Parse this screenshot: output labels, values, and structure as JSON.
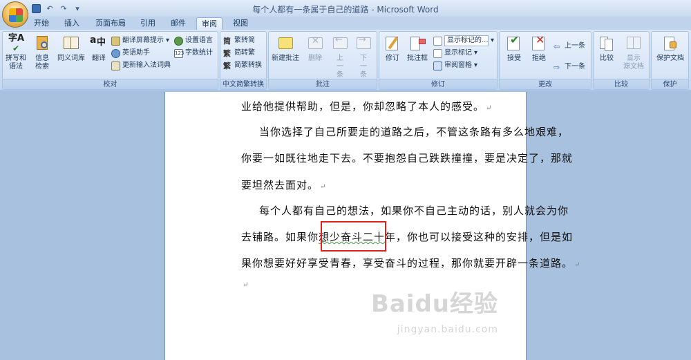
{
  "window": {
    "title": "每个人都有一条属于自己的道路 - Microsoft Word"
  },
  "tabs": [
    "开始",
    "插入",
    "页面布局",
    "引用",
    "邮件",
    "审阅",
    "视图"
  ],
  "active_tab": "审阅",
  "groups": {
    "proofing": {
      "label": "校对",
      "spell": "拼写和\n语法",
      "research": "信息\n检索",
      "thesaurus": "同义词库",
      "translate": "翻译",
      "translate_tip": "翻译屏幕提示",
      "english_assistant": "英语助手",
      "update_ime": "更新输入法词典",
      "set_language": "设置语言",
      "word_count": "字数统计"
    },
    "chinese": {
      "label": "中文简繁转换",
      "to_simplified": "繁转简",
      "to_traditional": "简转繁",
      "convert": "简繁转换"
    },
    "comments": {
      "label": "批注",
      "new": "新建批注",
      "delete": "删除",
      "prev": "上一条",
      "next": "下一条"
    },
    "tracking": {
      "label": "修订",
      "track": "修订",
      "balloons": "批注框",
      "display_dropdown": "显示标记的...",
      "show_markup": "显示标记",
      "reviewing_pane": "审阅窗格"
    },
    "changes": {
      "label": "更改",
      "accept": "接受",
      "reject": "拒绝",
      "prev": "上一条",
      "next": "下一条"
    },
    "compare": {
      "label": "比较",
      "compare": "比较",
      "show_source": "显示\n源文档"
    },
    "protect": {
      "label": "保护",
      "protect_doc": "保护文档"
    }
  },
  "document": {
    "lines": [
      "业给他提供帮助，但是，你却忽略了本人的感受。",
      "当你选择了自己所要走的道路之后，不管这条路有多么地艰难，",
      "你要一如既往地走下去。不要抱怨自己跌跌撞撞，要是决定了，那就",
      "要坦然去面对。",
      "每个人都有自己的想法，如果你不自己主动的话，别人就会为你",
      "去铺路。如果你",
      "想少奋斗二十",
      "年，你也可以接受这种的安排，但是如",
      "果你想要好好享受青春，享受奋斗的过程，那你就要开辟一条道路。"
    ],
    "para_mark": "↵"
  },
  "watermark": {
    "brand": "Baidu经验",
    "url": "jingyan.baidu.com"
  },
  "colors": {
    "accent": "#e0201c",
    "ribbon": "#dbe7f6",
    "background": "#a8c1df"
  }
}
